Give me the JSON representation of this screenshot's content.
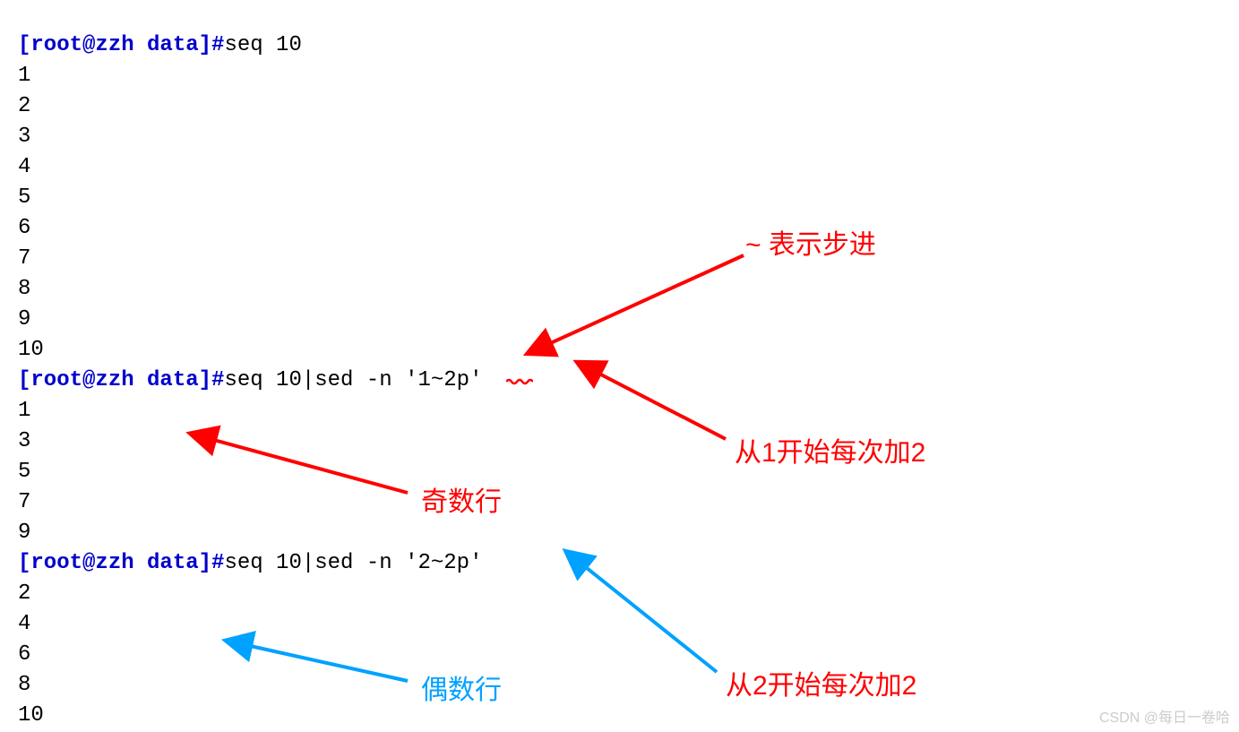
{
  "terminal": {
    "prompt": "[root@zzh data]#",
    "cmd1": "seq 10",
    "out1": [
      "1",
      "2",
      "3",
      "4",
      "5",
      "6",
      "7",
      "8",
      "9",
      "10"
    ],
    "cmd2": "seq 10|sed -n '1~2p'",
    "out2": [
      "1",
      "3",
      "5",
      "7",
      "9"
    ],
    "cmd3": "seq 10|sed -n '2~2p'",
    "out3": [
      "2",
      "4",
      "6",
      "8",
      "10"
    ]
  },
  "annotations": {
    "step": "~ 表示步进",
    "from1": "从1开始每次加2",
    "odd": "奇数行",
    "from2": "从2开始每次加2",
    "even": "偶数行"
  },
  "watermark": "CSDN @每日一卷哈"
}
